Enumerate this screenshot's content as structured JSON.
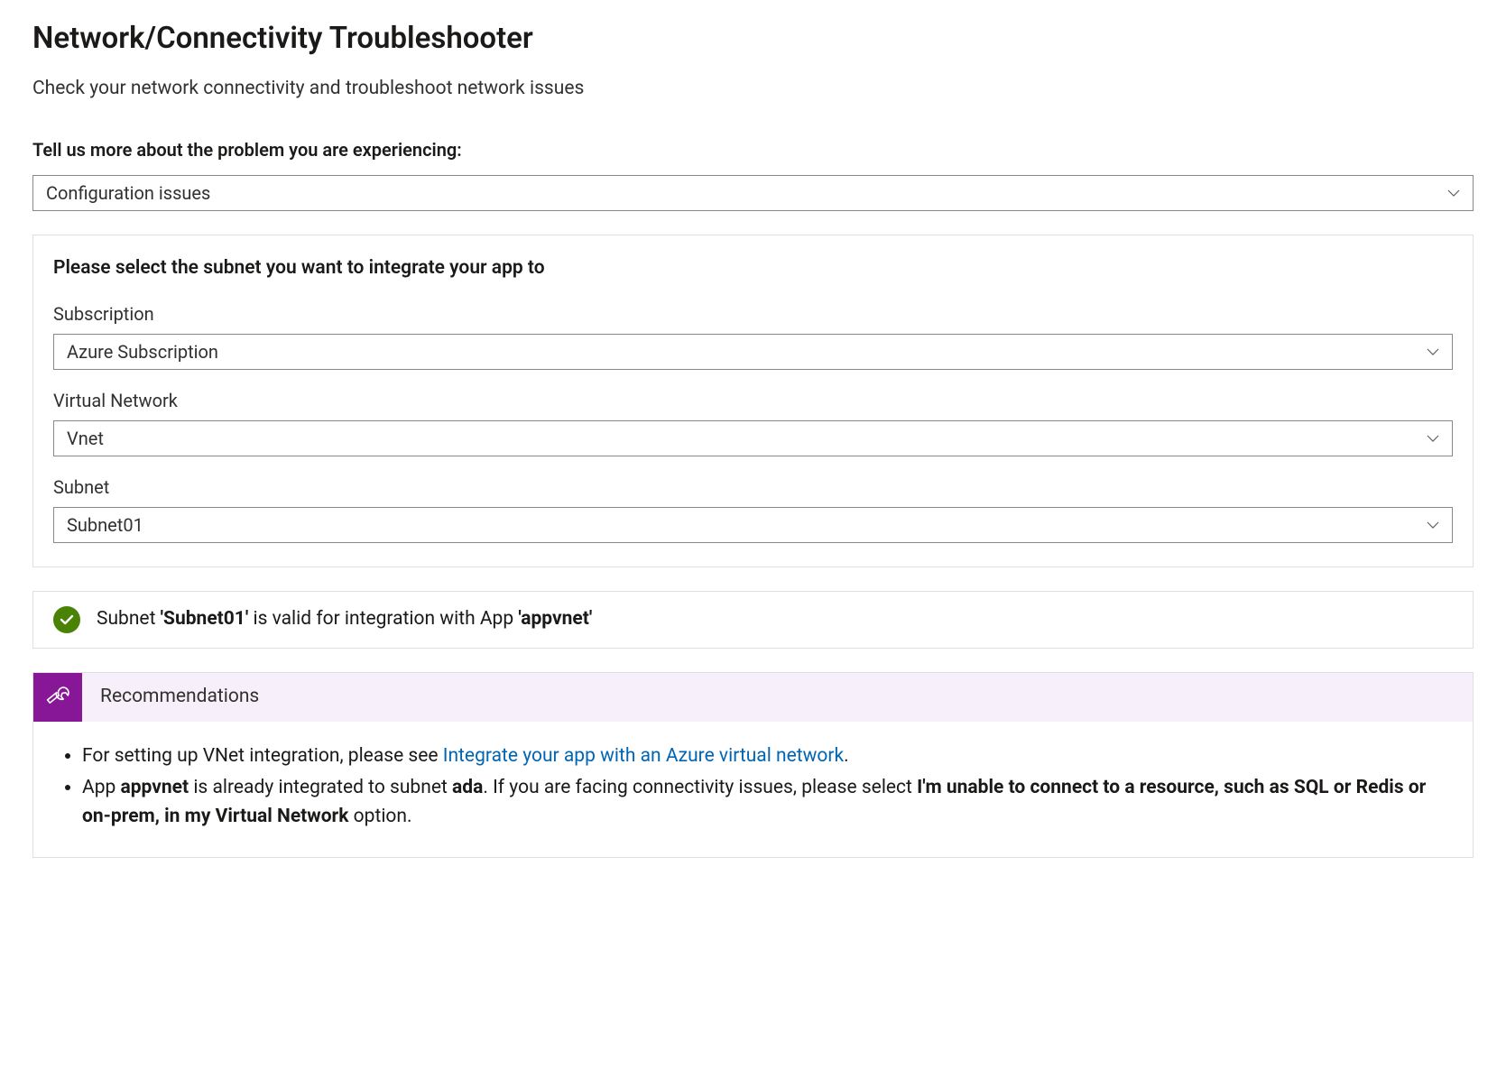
{
  "header": {
    "title": "Network/Connectivity Troubleshooter",
    "subtitle": "Check your network connectivity and troubleshoot network issues"
  },
  "problem": {
    "prompt": "Tell us more about the problem you are experiencing:",
    "selected": "Configuration issues"
  },
  "subnetSelection": {
    "title": "Please select the subnet you want to integrate your app to",
    "fields": {
      "subscription": {
        "label": "Subscription",
        "value": "Azure Subscription"
      },
      "vnet": {
        "label": "Virtual Network",
        "value": "Vnet"
      },
      "subnet": {
        "label": "Subnet",
        "value": "Subnet01"
      }
    }
  },
  "status": {
    "pre": "Subnet ",
    "subnetQuoted": "'Subnet01'",
    "mid": " is valid for integration with App ",
    "appQuoted": "'appvnet'"
  },
  "recommendations": {
    "title": "Recommendations",
    "item1": {
      "pre": "For setting up VNet integration, please see ",
      "link": "Integrate your app with an Azure virtual network",
      "post": "."
    },
    "item2": {
      "p1": "App ",
      "appName": "appvnet",
      "p2": " is already integrated to subnet ",
      "subnetName": "ada",
      "p3": ". If you are facing connectivity issues, please select ",
      "boldOption": "I'm unable to connect to a resource, such as SQL or Redis or on-prem, in my Virtual Network",
      "p4": " option."
    }
  }
}
